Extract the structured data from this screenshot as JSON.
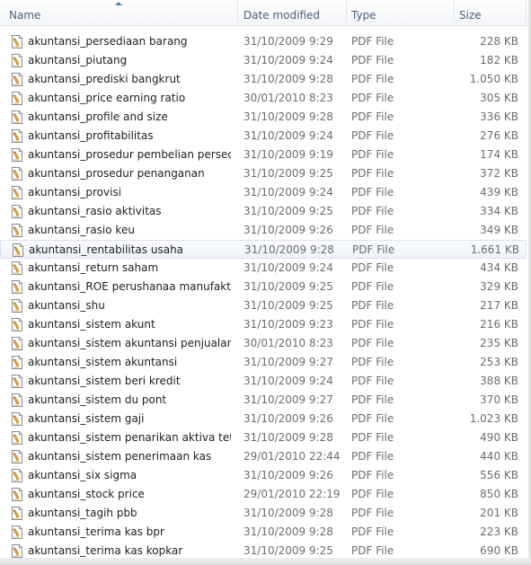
{
  "columns": {
    "name": "Name",
    "date_modified": "Date modified",
    "type": "Type",
    "size": "Size"
  },
  "files": [
    {
      "name": "akuntansi_persediaan barang",
      "date": "31/10/2009 9:29",
      "type": "PDF File",
      "size": "228 KB"
    },
    {
      "name": "akuntansi_piutang",
      "date": "31/10/2009 9:24",
      "type": "PDF File",
      "size": "182 KB"
    },
    {
      "name": "akuntansi_prediski bangkrut",
      "date": "31/10/2009 9:28",
      "type": "PDF File",
      "size": "1.050 KB"
    },
    {
      "name": "akuntansi_price earning ratio",
      "date": "30/01/2010 8:23",
      "type": "PDF File",
      "size": "305 KB"
    },
    {
      "name": "akuntansi_profile and size",
      "date": "31/10/2009 9:28",
      "type": "PDF File",
      "size": "336 KB"
    },
    {
      "name": "akuntansi_profitabilitas",
      "date": "31/10/2009 9:24",
      "type": "PDF File",
      "size": "276 KB"
    },
    {
      "name": "akuntansi_prosedur pembelian persediaa...",
      "date": "31/10/2009 9:19",
      "type": "PDF File",
      "size": "174 KB"
    },
    {
      "name": "akuntansi_prosedur penanganan",
      "date": "31/10/2009 9:25",
      "type": "PDF File",
      "size": "372 KB"
    },
    {
      "name": "akuntansi_provisi",
      "date": "31/10/2009 9:24",
      "type": "PDF File",
      "size": "439 KB"
    },
    {
      "name": "akuntansi_rasio aktivitas",
      "date": "31/10/2009 9:25",
      "type": "PDF File",
      "size": "334 KB"
    },
    {
      "name": "akuntansi_rasio keu",
      "date": "31/10/2009 9:26",
      "type": "PDF File",
      "size": "349 KB"
    },
    {
      "name": "akuntansi_rentabilitas usaha",
      "date": "31/10/2009 9:28",
      "type": "PDF File",
      "size": "1.661 KB",
      "selected": true
    },
    {
      "name": "akuntansi_return saham",
      "date": "31/10/2009 9:24",
      "type": "PDF File",
      "size": "434 KB"
    },
    {
      "name": "akuntansi_ROE perushanaa manufaktur",
      "date": "31/10/2009 9:25",
      "type": "PDF File",
      "size": "329 KB"
    },
    {
      "name": "akuntansi_shu",
      "date": "31/10/2009 9:25",
      "type": "PDF File",
      "size": "217 KB"
    },
    {
      "name": "akuntansi_sistem akunt",
      "date": "31/10/2009 9:23",
      "type": "PDF File",
      "size": "216 KB"
    },
    {
      "name": "akuntansi_sistem akuntansi penjualan",
      "date": "30/01/2010 8:23",
      "type": "PDF File",
      "size": "235 KB"
    },
    {
      "name": "akuntansi_sistem akuntansi",
      "date": "31/10/2009 9:27",
      "type": "PDF File",
      "size": "253 KB"
    },
    {
      "name": "akuntansi_sistem beri kredit",
      "date": "31/10/2009 9:24",
      "type": "PDF File",
      "size": "388 KB"
    },
    {
      "name": "akuntansi_sistem du pont",
      "date": "31/10/2009 9:27",
      "type": "PDF File",
      "size": "370 KB"
    },
    {
      "name": "akuntansi_sistem gaji",
      "date": "31/10/2009 9:26",
      "type": "PDF File",
      "size": "1.023 KB"
    },
    {
      "name": "akuntansi_sistem penarikan aktiva tetap",
      "date": "31/10/2009 9:28",
      "type": "PDF File",
      "size": "490 KB"
    },
    {
      "name": "akuntansi_sistem penerimaan kas",
      "date": "29/01/2010 22:44",
      "type": "PDF File",
      "size": "440 KB"
    },
    {
      "name": "akuntansi_six sigma",
      "date": "31/10/2009 9:26",
      "type": "PDF File",
      "size": "556 KB"
    },
    {
      "name": "akuntansi_stock price",
      "date": "29/01/2010 22:19",
      "type": "PDF File",
      "size": "850 KB"
    },
    {
      "name": "akuntansi_tagih pbb",
      "date": "31/10/2009 9:28",
      "type": "PDF File",
      "size": "201 KB"
    },
    {
      "name": "akuntansi_terima kas bpr",
      "date": "31/10/2009 9:28",
      "type": "PDF File",
      "size": "223 KB"
    },
    {
      "name": "akuntansi_terima kas kopkar",
      "date": "31/10/2009 9:25",
      "type": "PDF File",
      "size": "690 KB"
    }
  ],
  "icons": {
    "file": "pdf-file-icon",
    "sort": "sort-ascending-icon"
  },
  "colors": {
    "header_text": "#4c607a",
    "selection_border": "#d9e2ee",
    "icon_accent": "#e8a534"
  }
}
